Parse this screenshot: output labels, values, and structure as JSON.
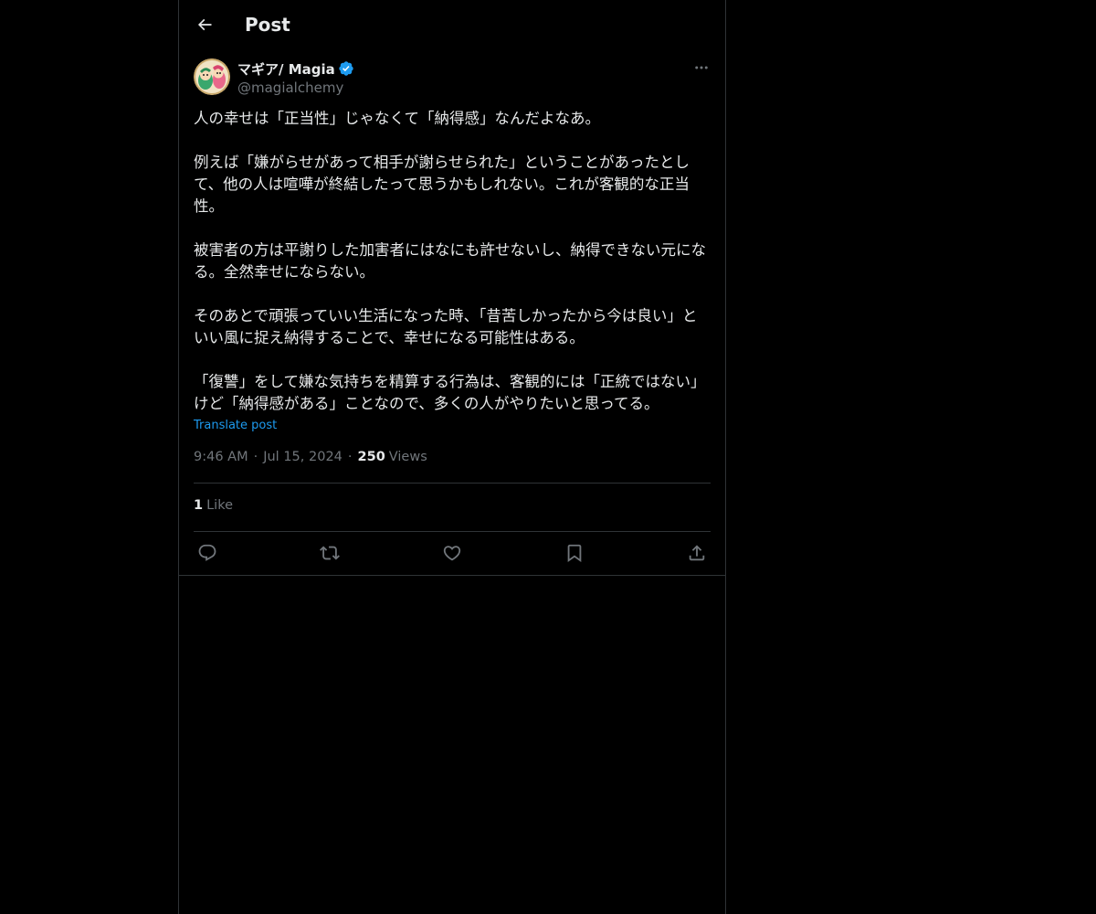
{
  "header": {
    "title": "Post",
    "back_icon": "arrow-left-icon"
  },
  "author": {
    "display_name": "マギア/ Magia",
    "handle": "@magialchemy",
    "verified": true,
    "verified_color": "#1d9bf0"
  },
  "post": {
    "paragraphs": [
      "人の幸せは「正当性」じゃなくて「納得感」なんだよなあ。",
      "例えば「嫌がらせがあって相手が謝らせられた」ということがあったとして、他の人は喧嘩が終結したって思うかもしれない。これが客観的な正当性。",
      "被害者の方は平謝りした加害者にはなにも許せないし、納得できない元になる。全然幸せにならない。",
      "そのあとで頑張っていい生活になった時、「昔苦しかったから今は良い」といい風に捉え納得することで、幸せになる可能性はある。",
      "「復讐」をして嫌な気持ちを精算する行為は、客観的には「正統ではない」けど「納得感がある」ことなので、多くの人がやりたいと思ってる。"
    ],
    "translate_label": "Translate post",
    "time": "9:46 AM",
    "date": "Jul 15, 2024",
    "views_count": "250",
    "views_label": "Views",
    "likes_count": "1",
    "likes_label": "Like"
  },
  "actions": [
    {
      "name": "reply-icon"
    },
    {
      "name": "repost-icon"
    },
    {
      "name": "like-icon"
    },
    {
      "name": "bookmark-icon"
    },
    {
      "name": "share-icon"
    }
  ],
  "colors": {
    "background": "#000000",
    "text": "#e7e9ea",
    "secondary": "#71767b",
    "accent": "#1d9bf0",
    "border": "#2f3336"
  }
}
